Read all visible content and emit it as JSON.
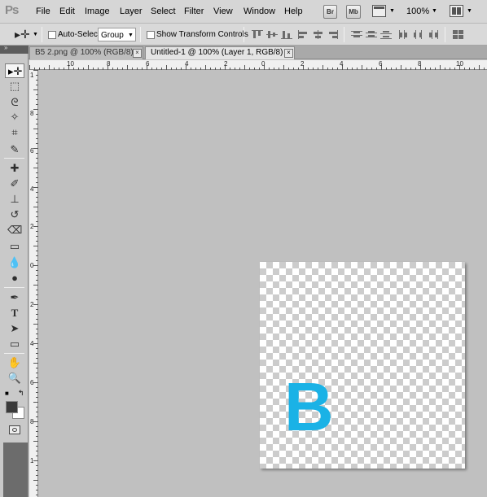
{
  "app": {
    "logo": "Ps"
  },
  "menu": [
    "File",
    "Edit",
    "Image",
    "Layer",
    "Select",
    "Filter",
    "View",
    "Window",
    "Help"
  ],
  "appbar": {
    "bridge_label": "Br",
    "minibridge_label": "Mb",
    "zoom": "100%"
  },
  "options": {
    "auto_select_label": "Auto-Select:",
    "auto_select_value": "Group",
    "show_transform_label": "Show Transform Controls"
  },
  "tabs": [
    {
      "label": "B5 2.png @ 100% (RGB/8)",
      "active": false
    },
    {
      "label": "Untitled-1 @ 100% (Layer 1, RGB/8) *",
      "active": true
    }
  ],
  "ruler_h": [
    "10",
    "8",
    "6",
    "4",
    "2",
    "0",
    "2",
    "4",
    "6",
    "8",
    "10"
  ],
  "ruler_v": [
    "1",
    "8",
    "6",
    "4",
    "2",
    "0",
    "2",
    "4",
    "6",
    "8",
    "1"
  ],
  "canvas": {
    "letter": "B",
    "letter_color": "#1ab2e6"
  },
  "colors": {
    "foreground": "#3a3a3a",
    "background": "#ffffff",
    "workspace": "#c0c0c0"
  }
}
